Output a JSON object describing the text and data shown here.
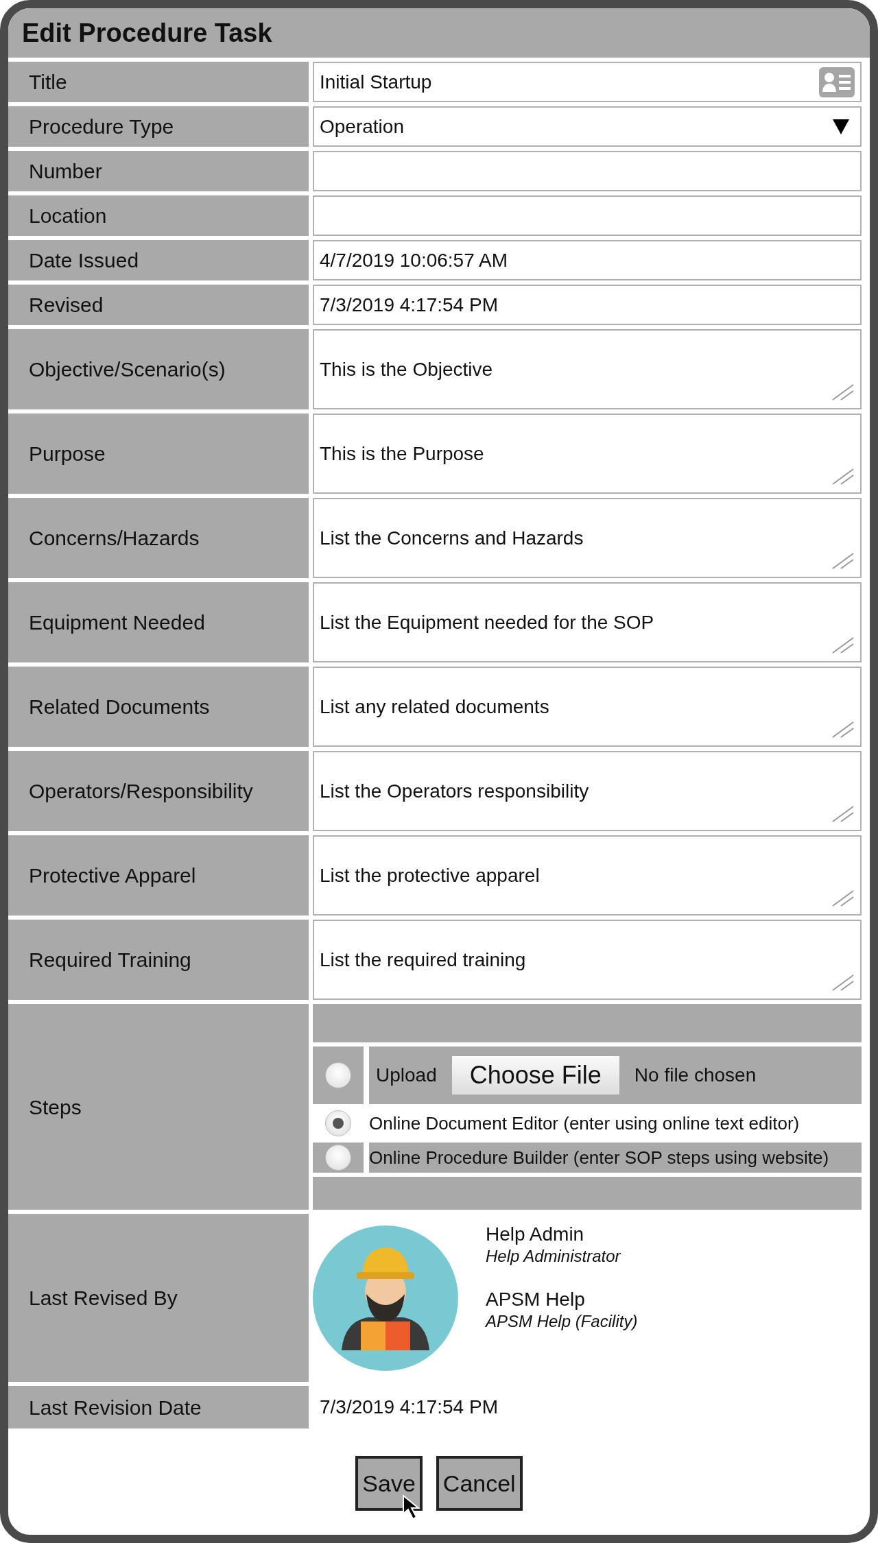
{
  "window": {
    "title": "Edit Procedure Task"
  },
  "fields": [
    {
      "kind": "text",
      "label": "Title",
      "value": "Initial Startup",
      "has_card_icon": true
    },
    {
      "kind": "select",
      "label": "Procedure Type",
      "value": "Operation"
    },
    {
      "kind": "text",
      "label": "Number"
    },
    {
      "kind": "text",
      "label": "Location"
    },
    {
      "kind": "text",
      "label": "Date Issued",
      "value": "4/7/2019 10:06:57 AM"
    },
    {
      "kind": "text",
      "label": "Revised",
      "value": "7/3/2019 4:17:54 PM"
    },
    {
      "kind": "textarea",
      "label": "Objective/Scenario(s)",
      "value": "This is the Objective"
    },
    {
      "kind": "textarea",
      "label": "Purpose",
      "value": "This is the Purpose"
    },
    {
      "kind": "textarea",
      "label": "Concerns/Hazards",
      "value": "List the Concerns and Hazards"
    },
    {
      "kind": "textarea",
      "label": "Equipment Needed",
      "value": "List the Equipment needed for the SOP"
    },
    {
      "kind": "textarea",
      "label": "Related Documents",
      "value": "List any related documents"
    },
    {
      "kind": "textarea",
      "label": "Operators/Responsibility",
      "value": "List the Operators responsibility"
    },
    {
      "kind": "textarea",
      "label": "Protective Apparel",
      "value": "List the protective apparel"
    },
    {
      "kind": "textarea",
      "label": "Required Training",
      "value": "List the required training"
    },
    {
      "kind": "steps",
      "label": "Steps",
      "options": [
        {
          "kind": "upload",
          "label": "Upload",
          "button": "Choose File",
          "status": "No file chosen",
          "selected": false
        },
        {
          "kind": "plain",
          "label": "Online Document Editor (enter using online text editor)",
          "selected": true
        },
        {
          "kind": "plain",
          "label": "Online Procedure Builder (enter SOP steps using website)",
          "selected": false
        }
      ]
    },
    {
      "kind": "revisers",
      "label": "Last Revised By",
      "people": [
        {
          "name": "Help Admin",
          "role": "Help Administrator"
        },
        {
          "name": "APSM Help",
          "role": "APSM Help (Facility)"
        }
      ]
    },
    {
      "kind": "plain",
      "label": "Last Revision Date",
      "value": "7/3/2019 4:17:54 PM"
    }
  ],
  "buttons": [
    "Save",
    "Cancel"
  ]
}
